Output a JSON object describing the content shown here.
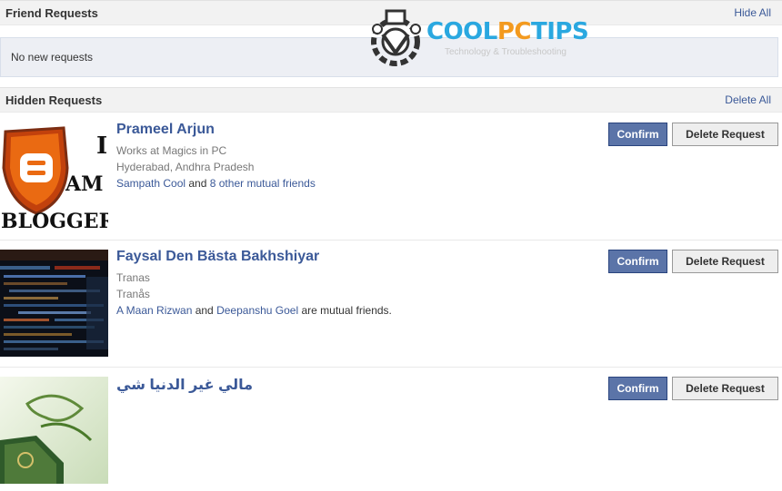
{
  "friend_requests": {
    "title": "Friend Requests",
    "hide_all": "Hide All",
    "empty_text": "No new requests"
  },
  "hidden_requests": {
    "title": "Hidden Requests",
    "delete_all": "Delete All"
  },
  "buttons": {
    "confirm": "Confirm",
    "delete": "Delete Request"
  },
  "requests": [
    {
      "name": "Prameel Arjun",
      "line1": "Works at Magics in PC",
      "line2": "Hyderabad, Andhra Pradesh",
      "mutual_friend": "Sampath Cool",
      "mutual_and": " and ",
      "mutual_others": "8 other mutual friends",
      "thumb_text": "BLOGGER"
    },
    {
      "name": "Faysal Den Bästa Bakhshiyar",
      "line1": "Tranas",
      "line2": "Tranås",
      "mutual_friend": "A Maan Rizwan",
      "mutual_and": " and ",
      "mutual_others": "Deepanshu Goel",
      "mutual_suffix": " are mutual friends."
    },
    {
      "name": "مالي غير الدنيا شي"
    }
  ],
  "watermark": {
    "brand_part1": "COOL",
    "brand_part2": "PC",
    "brand_part3": "TIPS",
    "tagline": "Technology & Troubleshooting"
  }
}
